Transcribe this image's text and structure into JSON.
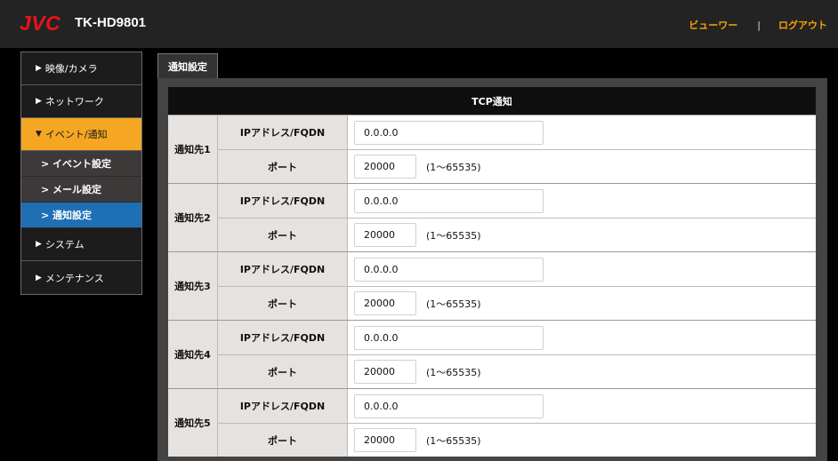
{
  "header": {
    "logo": "JVC",
    "model": "TK-HD9801",
    "viewer_link": "ビューワー",
    "separator": "|",
    "logout_link": "ログアウト"
  },
  "sidebar": {
    "items": [
      {
        "label": "映像/カメラ",
        "arrow": "▶"
      },
      {
        "label": "ネットワーク",
        "arrow": "▶"
      },
      {
        "label": "イベント/通知",
        "arrow": "▼",
        "active": true
      },
      {
        "label": "システム",
        "arrow": "▶"
      },
      {
        "label": "メンテナンス",
        "arrow": "▶"
      }
    ],
    "subitems": [
      {
        "label": "> イベント設定"
      },
      {
        "label": "> メール設定"
      },
      {
        "label": "> 通知設定",
        "selected": true
      }
    ]
  },
  "main": {
    "tab_label": "通知設定",
    "table_header": "TCP通知",
    "ip_label": "IPアドレス/FQDN",
    "port_label": "ポート",
    "range_text": "(1〜65535)",
    "destinations": [
      {
        "label": "通知先1",
        "ip": "0.0.0.0",
        "port": "20000"
      },
      {
        "label": "通知先2",
        "ip": "0.0.0.0",
        "port": "20000"
      },
      {
        "label": "通知先3",
        "ip": "0.0.0.0",
        "port": "20000"
      },
      {
        "label": "通知先4",
        "ip": "0.0.0.0",
        "port": "20000"
      },
      {
        "label": "通知先5",
        "ip": "0.0.0.0",
        "port": "20000"
      }
    ]
  },
  "colors": {
    "accent": "#f5a623",
    "selected": "#1f6fb5",
    "logo": "#e8141a"
  }
}
